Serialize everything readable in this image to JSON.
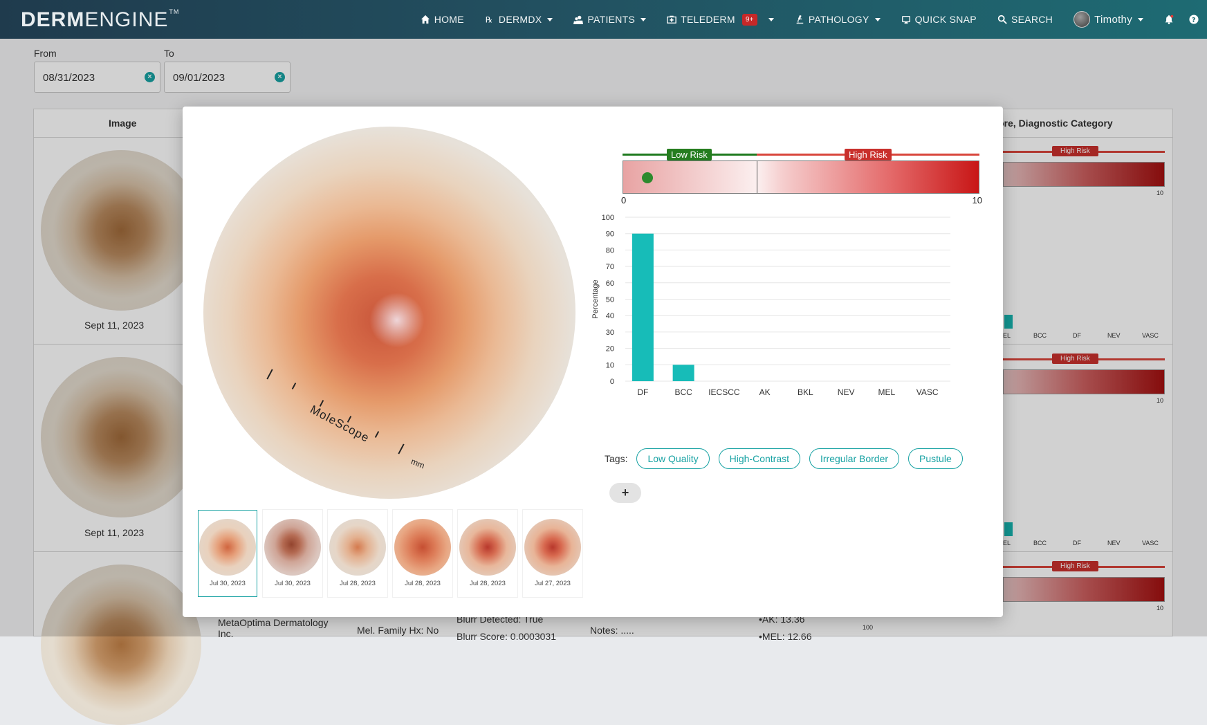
{
  "nav": {
    "logo_bold": "DERM",
    "logo_thin": "ENGINE",
    "logo_tm": "TM",
    "items": [
      {
        "label": "HOME",
        "icon": "home-icon"
      },
      {
        "label": "DERMDX",
        "icon": "rx-icon"
      },
      {
        "label": "PATIENTS",
        "icon": "patients-icon"
      },
      {
        "label": "TELEDERM",
        "icon": "telederm-icon",
        "badge": "9+"
      },
      {
        "label": "PATHOLOGY",
        "icon": "microscope-icon"
      },
      {
        "label": "QUICK SNAP",
        "icon": "snap-icon"
      },
      {
        "label": "SEARCH",
        "icon": "search-icon"
      },
      {
        "label": "Timothy",
        "icon": "avatar"
      }
    ]
  },
  "filters": {
    "from_label": "From",
    "from_value": "08/31/2023",
    "to_label": "To",
    "to_value": "09/01/2023"
  },
  "table": {
    "col_image": "Image",
    "col_score": "ore, Diagnostic Category",
    "rows": [
      {
        "date": "Sept 11, 2023"
      },
      {
        "date": "Sept 11, 2023"
      }
    ],
    "partial": {
      "org": "MetaOptima Dermatology",
      "org2": "Inc.",
      "mel_family": "Mel. Family Hx: No",
      "blurr_detected": "Blurr Detected: True",
      "blurr_score": "Blurr Score: 0.0003031",
      "notes": "Notes: .....",
      "ak": "•AK: 13.36",
      "mel": "•MEL: 12.66",
      "hundred": "100"
    },
    "mini_risk_label": "High Risk",
    "mini_risk_max": "10",
    "mini_categories": [
      "EL",
      "BCC",
      "DF",
      "NEV",
      "VASC"
    ]
  },
  "modal": {
    "ruler_text": "MoleScope",
    "ruler_unit": "mm",
    "risk": {
      "low_label": "Low Risk",
      "high_label": "High Risk",
      "min": "0",
      "max": "10",
      "score": 0.5,
      "colors": {
        "low": "#257d1f",
        "high": "#c9302c"
      }
    },
    "thumbnails": [
      {
        "date": "Jul 30, 2023",
        "active": true
      },
      {
        "date": "Jul 30, 2023",
        "active": false
      },
      {
        "date": "Jul 28, 2023",
        "active": false
      },
      {
        "date": "Jul 28, 2023",
        "active": false
      },
      {
        "date": "Jul 28, 2023",
        "active": false
      },
      {
        "date": "Jul 27, 2023",
        "active": false
      }
    ],
    "tags_label": "Tags:",
    "tags": [
      "Low Quality",
      "High-Contrast",
      "Irregular Border",
      "Pustule"
    ],
    "add_tag": "+"
  },
  "chart_data": {
    "type": "bar",
    "categories": [
      "DF",
      "BCC",
      "IECSCC",
      "AK",
      "BKL",
      "NEV",
      "MEL",
      "VASC"
    ],
    "values": [
      90,
      10,
      0,
      0,
      0,
      0,
      0,
      0
    ],
    "ylabel": "Percentage",
    "xlabel": "",
    "ylim": [
      0,
      100
    ],
    "yticks": [
      0,
      10,
      20,
      30,
      40,
      50,
      60,
      70,
      80,
      90,
      100
    ],
    "grid": true,
    "color": "#17bcb8"
  }
}
